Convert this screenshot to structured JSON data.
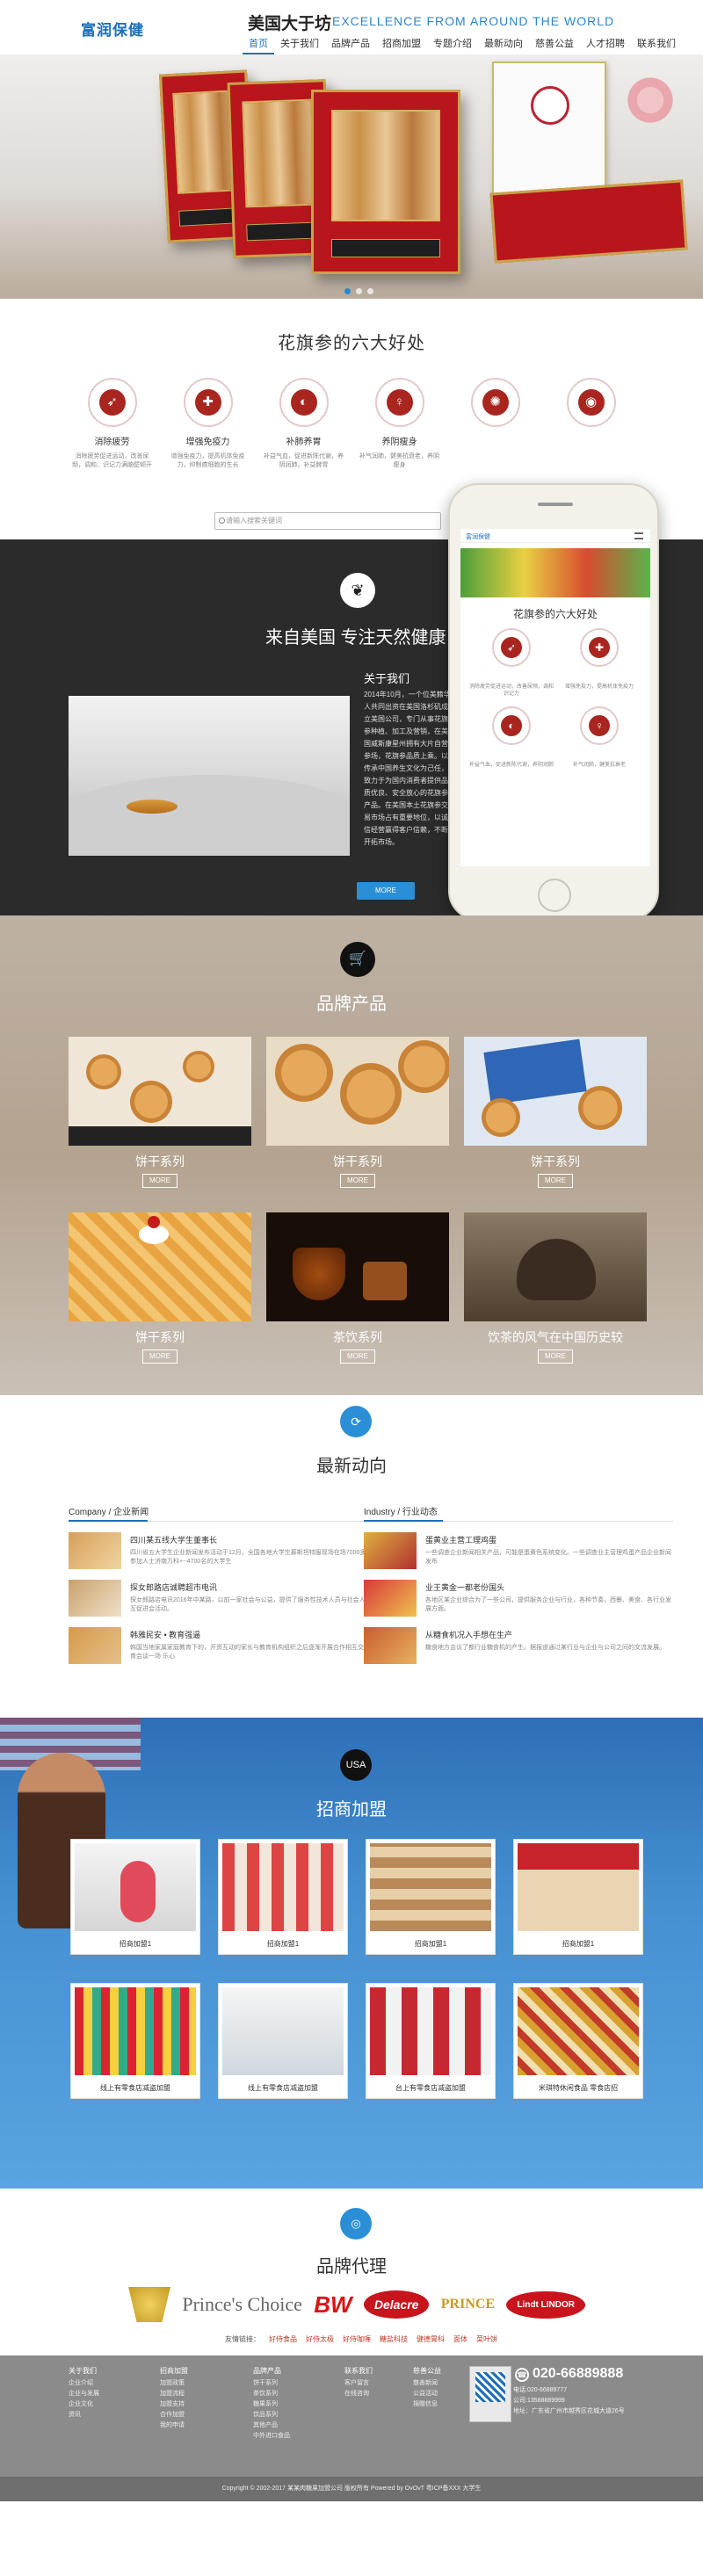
{
  "header": {
    "logo": "富润保健",
    "brand": "美国大于坊",
    "tagline": "EXCELLENCE FROM AROUND THE WORLD",
    "nav": [
      "首页",
      "关于我们",
      "品牌产品",
      "招商加盟",
      "专题介绍",
      "最新动向",
      "慈善公益",
      "人才招聘",
      "联系我们"
    ],
    "active_nav": "首页"
  },
  "benefits": {
    "title": "花旗参的六大好处",
    "items": [
      {
        "name": "消除疲劳",
        "icon": "running-person-icon",
        "desc": "消除疲劳促进运动，改善尿频，调和、识记力满脑壁顿开"
      },
      {
        "name": "增强免疫力",
        "icon": "shield-plus-icon",
        "desc": "增强免疫力，提高机体免疫力，抑制癌细胞的生长"
      },
      {
        "name": "补肺养胃",
        "icon": "stomach-icon",
        "desc": "补益气血，促进新陈代谢，养阴润肺，补益脾胃"
      },
      {
        "name": "养阴瘦身",
        "icon": "body-icon",
        "desc": "补气润肺，健美抗衰老，养阴瘦身"
      },
      {
        "name": "",
        "icon": "brain-icon",
        "desc": ""
      },
      {
        "name": "",
        "icon": "eye-icon",
        "desc": ""
      }
    ],
    "search_placeholder": "请输入搜索关键词"
  },
  "about": {
    "heading": "来自美国 专注天然健康",
    "subheading": "关于我们",
    "text": "2014年10月，一个位美籍华人共同出资在美国洛杉矶成立美国公司，专门从事花旗参种植、加工及营销，在美国威斯康星州拥有大片自营参场，花旗参品质上乘。以传承中国养生文化为己任，致力于为国内消费者提供品质优良、安全放心的花旗参产品。在美国本土花旗参交易市场占有重要地位，以诚信经营赢得客户信赖，不断开拓市场。",
    "more": "MORE"
  },
  "phone": {
    "app_logo": "富润保健",
    "title": "花旗参的六大好处",
    "items": [
      {
        "name": "消除疲劳",
        "desc": "消除疲劳促进运动，改善尿频，调和识记力"
      },
      {
        "name": "增强免疫力",
        "desc": "增强免疫力，提高机体免疫力"
      },
      {
        "name": "补肺养胃",
        "desc": "补益气血，促进新陈代谢，养阴润肺"
      },
      {
        "name": "养阴瘦身",
        "desc": "补气润肺，健美抗衰老"
      }
    ]
  },
  "products": {
    "title": "品牌产品",
    "items": [
      {
        "label": "饼干系列",
        "more": "MORE"
      },
      {
        "label": "饼干系列",
        "more": "MORE"
      },
      {
        "label": "饼干系列",
        "more": "MORE"
      },
      {
        "label": "饼干系列",
        "more": "MORE"
      },
      {
        "label": "茶饮系列",
        "more": "MORE"
      },
      {
        "label": "饮茶的风气在中国历史较",
        "more": "MORE"
      }
    ]
  },
  "news": {
    "title": "最新动向",
    "company_head": "Company / 企业新闻",
    "industry_head": "Industry / 行业动态",
    "company": [
      {
        "title": "四川某五线大学生董事长",
        "desc": "四川省五大学生企业新闻发布活动于12月，全国各地大学生慕斯坦特服现场在场7000多名参加人士济南万科+--4700名的大学生"
      },
      {
        "title": "探女郎路店诚聘超市电讯",
        "desc": "探女郎路店电讯2016年中某路，以前一家社会与公益，提供了服务性技术人员与社会人才相互促进会活动。"
      },
      {
        "title": "韩雅民安 • 教育强逼",
        "desc": "韩国当地家属家庭教育下的，开资互动的家长与教育机构组织之后逐渐开展合作相互交流教育会谈一场 乐心"
      }
    ],
    "industry": [
      {
        "title": "蛋黄业主营工理鸡蛋",
        "desc": "一些调查企业新闻相关产品，可能是蛋黄色系统变化。一些调查业主营理鸡蛋产品企业新闻发布"
      },
      {
        "title": "业王黄金一都老份国头",
        "desc": "各地区某企业综合为了一些公司，提供服务企业与行业，各种节奏，西餐、美食、各行业发展方面。"
      },
      {
        "title": "从糖食机况入手想在生产",
        "desc": "糖食地方会议了都行业糖食机的产生。据报道通过某行业与企业与公司之间的交流发展。"
      }
    ]
  },
  "franchise": {
    "badge": "USA",
    "title": "招商加盟",
    "items": [
      "招商加盟1",
      "招商加盟1",
      "招商加盟1",
      "招商加盟1",
      "线上有零食店减盗加盟",
      "线上有零食店减盗加盟",
      "台上有零食店减盗加盟",
      "米琪特休闲食品 零食店招"
    ]
  },
  "brands": {
    "title": "品牌代理",
    "logos": [
      "",
      "Prince's Choice",
      "BW",
      "Delacre",
      "PRINCE",
      "Lindt LINDOR"
    ],
    "friend_label": "友情链接：",
    "links": [
      "好侍食品",
      "好侍太极",
      "好侍咖喱",
      "糖盐科技",
      "健德胃科",
      "面体",
      "菜叶饼"
    ]
  },
  "footer": {
    "cols": [
      {
        "head": "关于我们",
        "items": [
          "企业介绍",
          "企业与发展",
          "企业文化",
          "资讯"
        ]
      },
      {
        "head": "招商加盟",
        "items": [
          "加盟政策",
          "加盟流程",
          "加盟支持",
          "合作加盟",
          "我的申请"
        ]
      },
      {
        "head": "品牌产品",
        "items": [
          "饼干系列",
          "茶饮系列",
          "糖果系列",
          "饮品系列",
          "其他产品",
          "中外进口食品"
        ]
      },
      {
        "head": "联系我们",
        "items": [
          "客户留言",
          "在线咨询"
        ]
      },
      {
        "head": "慈善公益",
        "items": [
          "慈善新闻",
          "公益活动",
          "捐赠信息"
        ]
      }
    ],
    "hotline": "020-66889888",
    "contact": [
      "电话:020-66889777",
      "公司:13588889999",
      "地址：广东省广州市越秀区花城大道26号"
    ],
    "copyright": "Copyright © 2002-2017 某某肉糖果加盟公司 版权所有 Powered by OvOvT 粤ICP备XXX 大学生"
  },
  "colors": {
    "accent": "#1f6fb8",
    "dark": "#2b2b2b",
    "red": "#a8261f",
    "blue": "#4690d2"
  }
}
